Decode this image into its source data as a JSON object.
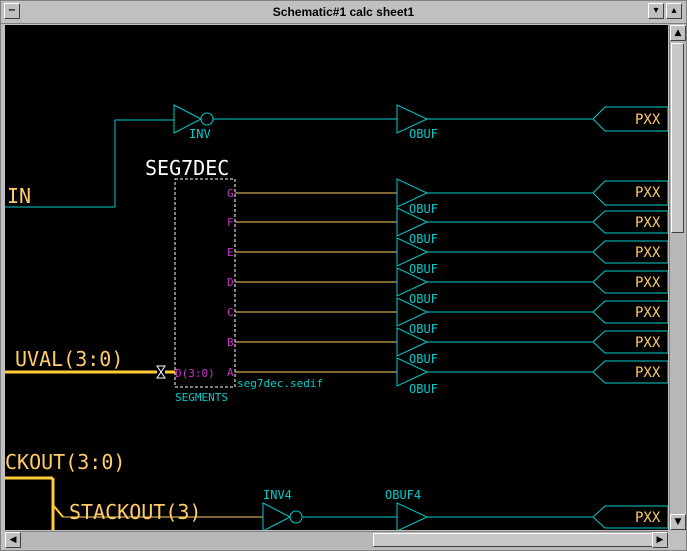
{
  "window": {
    "title": "Schematic#1 calc sheet1"
  },
  "colors": {
    "wire": "#00cccc",
    "bus": "#ffcc33",
    "net": "#ffcc66",
    "pin": "#cc33cc",
    "text": "#ffffff",
    "background": "#000000"
  },
  "schematic": {
    "nets": {
      "in": "IN",
      "uval": "UVAL(3:0)",
      "ckout": "CKOUT(3:0)",
      "stackout": "STACKOUT(3)"
    },
    "decoder": {
      "title": "SEG7DEC",
      "input_pin": "D(3:0)",
      "outputs": [
        "G",
        "F",
        "E",
        "D",
        "C",
        "B",
        "A"
      ],
      "instance": "SEGMENTS",
      "file": "seg7dec.sedif"
    },
    "inverters": [
      "INV",
      "INV4"
    ],
    "buffer_label": "OBUF",
    "buffer4_label": "OBUF4",
    "port_label": "PXX"
  }
}
